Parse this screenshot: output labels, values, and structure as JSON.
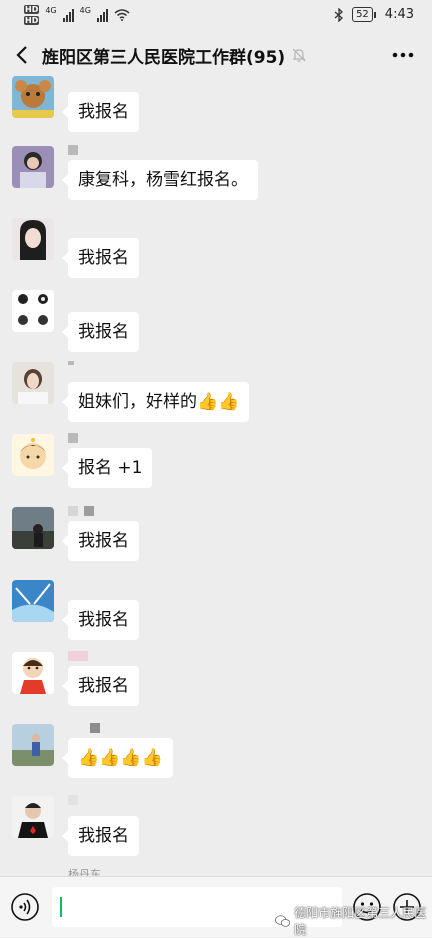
{
  "status_bar": {
    "hd1": "HD",
    "hd2": "HD",
    "net1": "4G",
    "net2": "4G",
    "battery": "52",
    "time": "4:43"
  },
  "header": {
    "back_icon": "chevron-left-icon",
    "title": "旌阳区第三人民医院工作群(95)",
    "mute_icon": "bell-muted-icon",
    "more_icon": "more-dots-icon"
  },
  "messages": [
    {
      "text": "我报名"
    },
    {
      "text": "康复科，杨雪红报名。"
    },
    {
      "text": "我报名"
    },
    {
      "text": "我报名"
    },
    {
      "text": "姐妹们，好样的👍👍"
    },
    {
      "text": "报名 +1"
    },
    {
      "text": "我报名"
    },
    {
      "text": "我报名"
    },
    {
      "text": "我报名"
    },
    {
      "text": "👍👍👍👍"
    },
    {
      "text": "我报名"
    }
  ],
  "partial_name": "杨丹东",
  "input_bar": {
    "voice_icon": "voice-icon",
    "emoji_icon": "emoji-icon",
    "plus_icon": "plus-icon"
  },
  "watermark": "德阳市旌阳区第三人民医院",
  "colors": {
    "background": "#ededed",
    "bubble": "#ffffff",
    "cursor": "#07c160"
  }
}
